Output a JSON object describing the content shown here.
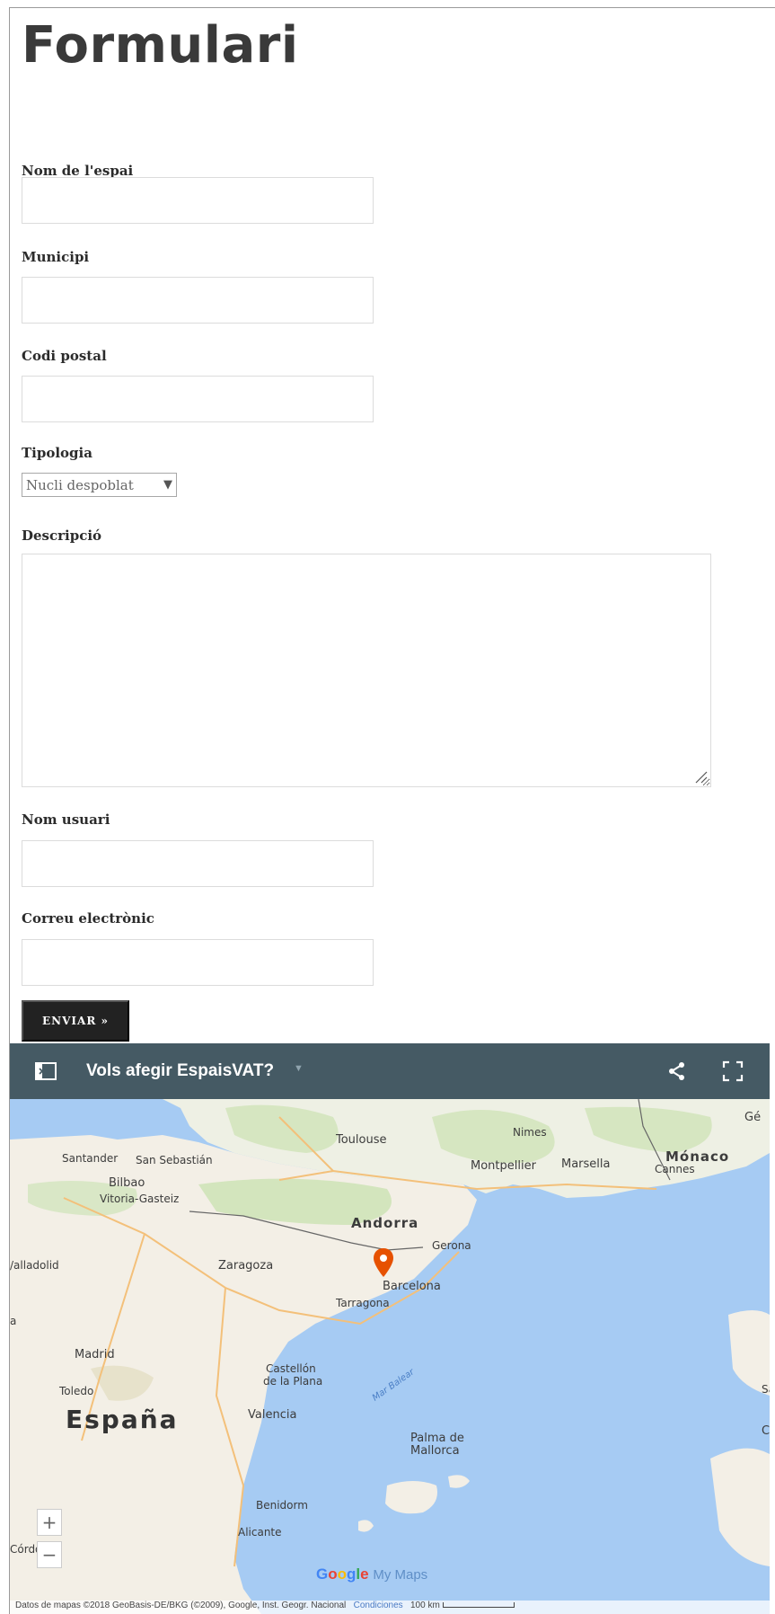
{
  "form": {
    "title": "Formulari",
    "fields": {
      "name_label": "Nom de l'espai",
      "municipality_label": "Municipi",
      "postal_label": "Codi postal",
      "type_label": "Tipologia",
      "type_value": "Nucli despoblat",
      "description_label": "Descripció",
      "user_label": "Nom usuari",
      "email_label": "Correu electrònic"
    },
    "submit_label": "ENVIAR »"
  },
  "map": {
    "title": "Vols afegir EspaisVAT?",
    "header_color": "#455a64",
    "icons": [
      "sidebar-toggle-icon",
      "share-icon",
      "fullscreen-icon"
    ],
    "labels": {
      "gen": "Gé",
      "santander": "Santander",
      "san_sebastian": "San Sebastián",
      "bilbao": "Bilbao",
      "vitoria": "Vitoria-Gasteiz",
      "toulouse": "Toulouse",
      "nimes": "Nimes",
      "monaco": "Mónaco",
      "montpellier": "Montpellier",
      "marsella": "Marsella",
      "cannes": "Cannes",
      "andorra": "Andorra",
      "gerona": "Gerona",
      "valladolid": "/alladolid",
      "zaragoza": "Zaragoza",
      "barcelona": "Barcelona",
      "tarragona": "Tarragona",
      "a": "a",
      "madrid": "Madrid",
      "castellon": "Castellón",
      "de_la_plana": "de la Plana",
      "mar_balear": "Mar Balear",
      "toledo": "Toledo",
      "espana": "España",
      "valencia": "Valencia",
      "palma": "Palma de",
      "mallorca": "Mallorca",
      "sar": "Sar",
      "c": "C",
      "benidorm": "Benidorm",
      "alicante": "Alicante",
      "cordoba": "Córdoba"
    },
    "zoom_in": "+",
    "zoom_out": "−",
    "brand_my_maps": "My Maps",
    "attribution": "Datos de mapas ©2018 GeoBasis-DE/BKG (©2009), Google, Inst. Geogr. Nacional",
    "conditions": "Condiciones",
    "scale": "100 km",
    "marker_color": "#e65100"
  }
}
